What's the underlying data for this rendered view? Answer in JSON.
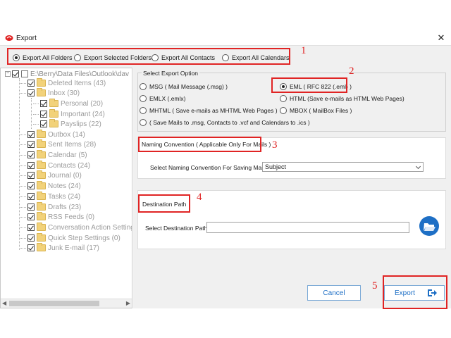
{
  "window": {
    "title": "Export",
    "close_glyph": "✕",
    "icon": "app-logo-icon"
  },
  "export_scope": {
    "options": [
      {
        "label": "Export All Folders",
        "selected": true
      },
      {
        "label": "Export Selected Folders",
        "selected": false
      },
      {
        "label": "Export All Contacts",
        "selected": false
      },
      {
        "label": "Export All Calendars",
        "selected": false
      }
    ]
  },
  "tree": {
    "root": "E:\\Berry\\Data Files\\Outlook\\dav",
    "items": [
      {
        "label": "Deleted Items (43)",
        "level": 1
      },
      {
        "label": "Inbox (30)",
        "level": 1
      },
      {
        "label": "Personal (20)",
        "level": 2
      },
      {
        "label": "Important (24)",
        "level": 2
      },
      {
        "label": "Payslips (22)",
        "level": 2
      },
      {
        "label": "Outbox (14)",
        "level": 1
      },
      {
        "label": "Sent Items (28)",
        "level": 1
      },
      {
        "label": "Calendar (5)",
        "level": 1
      },
      {
        "label": "Contacts (24)",
        "level": 1
      },
      {
        "label": "Journal (0)",
        "level": 1
      },
      {
        "label": "Notes (24)",
        "level": 1
      },
      {
        "label": "Tasks (24)",
        "level": 1
      },
      {
        "label": "Drafts (23)",
        "level": 1
      },
      {
        "label": "RSS Feeds (0)",
        "level": 1
      },
      {
        "label": "Conversation Action Setting",
        "level": 1
      },
      {
        "label": "Quick Step Settings (0)",
        "level": 1
      },
      {
        "label": "Junk E-mail (17)",
        "level": 1
      }
    ]
  },
  "export_option": {
    "title": "Select Export Option",
    "options": [
      {
        "label": "MSG ( Mail Message (.msg) )",
        "selected": false
      },
      {
        "label": "EML ( RFC 822 (.eml) )",
        "selected": true
      },
      {
        "label": "EMLX (.emlx)",
        "selected": false
      },
      {
        "label": "HTML (Save e-mails as HTML Web Pages)",
        "selected": false
      },
      {
        "label": "MHTML ( Save e-mails as MHTML Web Pages )",
        "selected": false
      },
      {
        "label": "MBOX ( MailBox Files )",
        "selected": false
      },
      {
        "label": "( Save Mails to .msg, Contacts to .vcf and Calendars to .ics )",
        "selected": false
      }
    ]
  },
  "naming": {
    "title": "Naming Convention ( Applicable Only For Mails )",
    "label": "Select Naming Convention For Saving Mails",
    "value": "Subject"
  },
  "destination": {
    "title": "Destination Path",
    "label": "Select Destination Path",
    "value": "",
    "browse_icon": "folder-open-icon"
  },
  "buttons": {
    "cancel": "Cancel",
    "export": "Export"
  },
  "annotations": [
    "1",
    "2",
    "3",
    "4",
    "5"
  ],
  "colors": {
    "annotation": "#e02424",
    "accent": "#1e6fc5"
  }
}
